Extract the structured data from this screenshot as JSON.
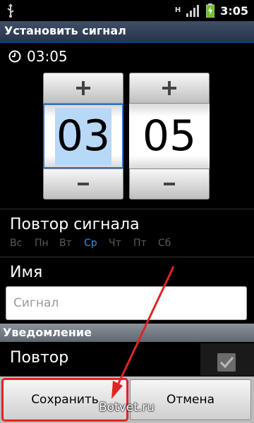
{
  "status_bar": {
    "time": "3:05",
    "network": "H",
    "icons": [
      "usb-icon",
      "network-h-icon",
      "signal-icon",
      "battery-icon"
    ]
  },
  "header": {
    "title": "Установить сигнал"
  },
  "summary": {
    "time": "03:05",
    "icon": "clock-icon"
  },
  "picker": {
    "hours": {
      "value": "03",
      "plus": "+",
      "minus": "−"
    },
    "minutes": {
      "value": "05",
      "plus": "+",
      "minus": "−"
    }
  },
  "repeat_section": {
    "title": "Повтор сигнала",
    "days": [
      {
        "label": "Вс",
        "active": false
      },
      {
        "label": "Пн",
        "active": false
      },
      {
        "label": "Вт",
        "active": false
      },
      {
        "label": "Ср",
        "active": true
      },
      {
        "label": "Чт",
        "active": false
      },
      {
        "label": "Пт",
        "active": false
      },
      {
        "label": "Сб",
        "active": false
      }
    ]
  },
  "name_section": {
    "title": "Имя",
    "placeholder": "Сигнал"
  },
  "notification": {
    "header": "Уведомление",
    "repeat_label": "Повтор",
    "repeat_checked": true
  },
  "buttons": {
    "save": "Сохранить",
    "cancel": "Отмена"
  },
  "watermark": "Botvet.ru",
  "colors": {
    "highlight": "#e02424",
    "accent": "#3a8fe0",
    "selection": "#b8d8f8"
  }
}
